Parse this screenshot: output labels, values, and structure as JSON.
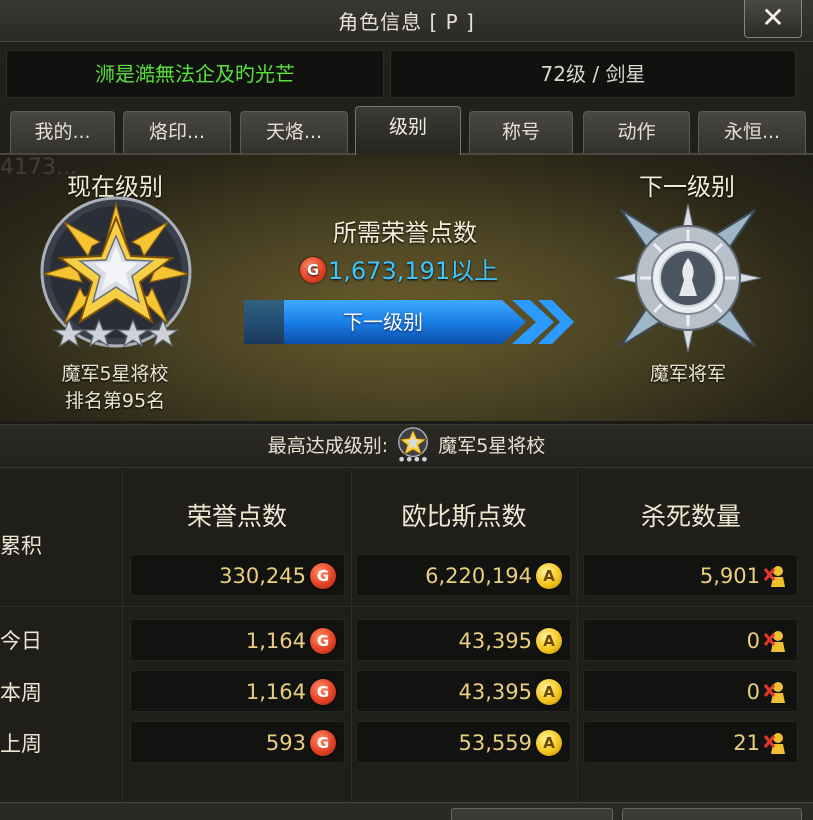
{
  "window": {
    "title": "角色信息 [ P ]",
    "close_symbol": "✕"
  },
  "character": {
    "name": "浉是澔無法企及旳光芒",
    "level_class": "72级 / 剑星"
  },
  "tabs": [
    {
      "label": "我的...",
      "active": false
    },
    {
      "label": "烙印...",
      "active": false
    },
    {
      "label": "天烙...",
      "active": false
    },
    {
      "label": "级别",
      "active": true
    },
    {
      "label": "称号",
      "active": false
    },
    {
      "label": "动作",
      "active": false
    },
    {
      "label": "永恒...",
      "active": false
    }
  ],
  "level": {
    "current_label": "现在级别",
    "next_label": "下一级别",
    "required_label": "所需荣誉点数",
    "required_value": "1,673,191以上",
    "next_button": "下一级别",
    "current_rank": "魔军5星将校",
    "current_position": "排名第95名",
    "next_rank": "魔军将军",
    "ghost_text": "4173..."
  },
  "best": {
    "label": "最高达成级别:",
    "rank": "魔军5星将校"
  },
  "stats": {
    "columns": [
      "荣誉点数",
      "欧比斯点数",
      "杀死数量"
    ],
    "rows": [
      {
        "label": "累积",
        "honor": "330,245",
        "orbis": "6,220,194",
        "kills": "5,901"
      },
      {
        "label": "今日",
        "honor": "1,164",
        "orbis": "43,395",
        "kills": "0"
      },
      {
        "label": "本周",
        "honor": "1,164",
        "orbis": "43,395",
        "kills": "0"
      },
      {
        "label": "上周",
        "honor": "593",
        "orbis": "53,559",
        "kills": "21"
      }
    ],
    "coin_honor": "G",
    "coin_orbis": "A"
  },
  "colors": {
    "name_green": "#58e23c",
    "points_blue": "#3dc6ff",
    "value_gold": "#e9cf7e",
    "arrow_blue": "#1a8cf0"
  },
  "icons": {
    "close": "close-icon",
    "current_badge": "gold-star-medal-icon",
    "next_badge": "silver-general-medal-icon",
    "honor_coin": "honor-coin-icon",
    "orbis_coin": "orbis-coin-icon",
    "kill": "kill-count-icon"
  }
}
